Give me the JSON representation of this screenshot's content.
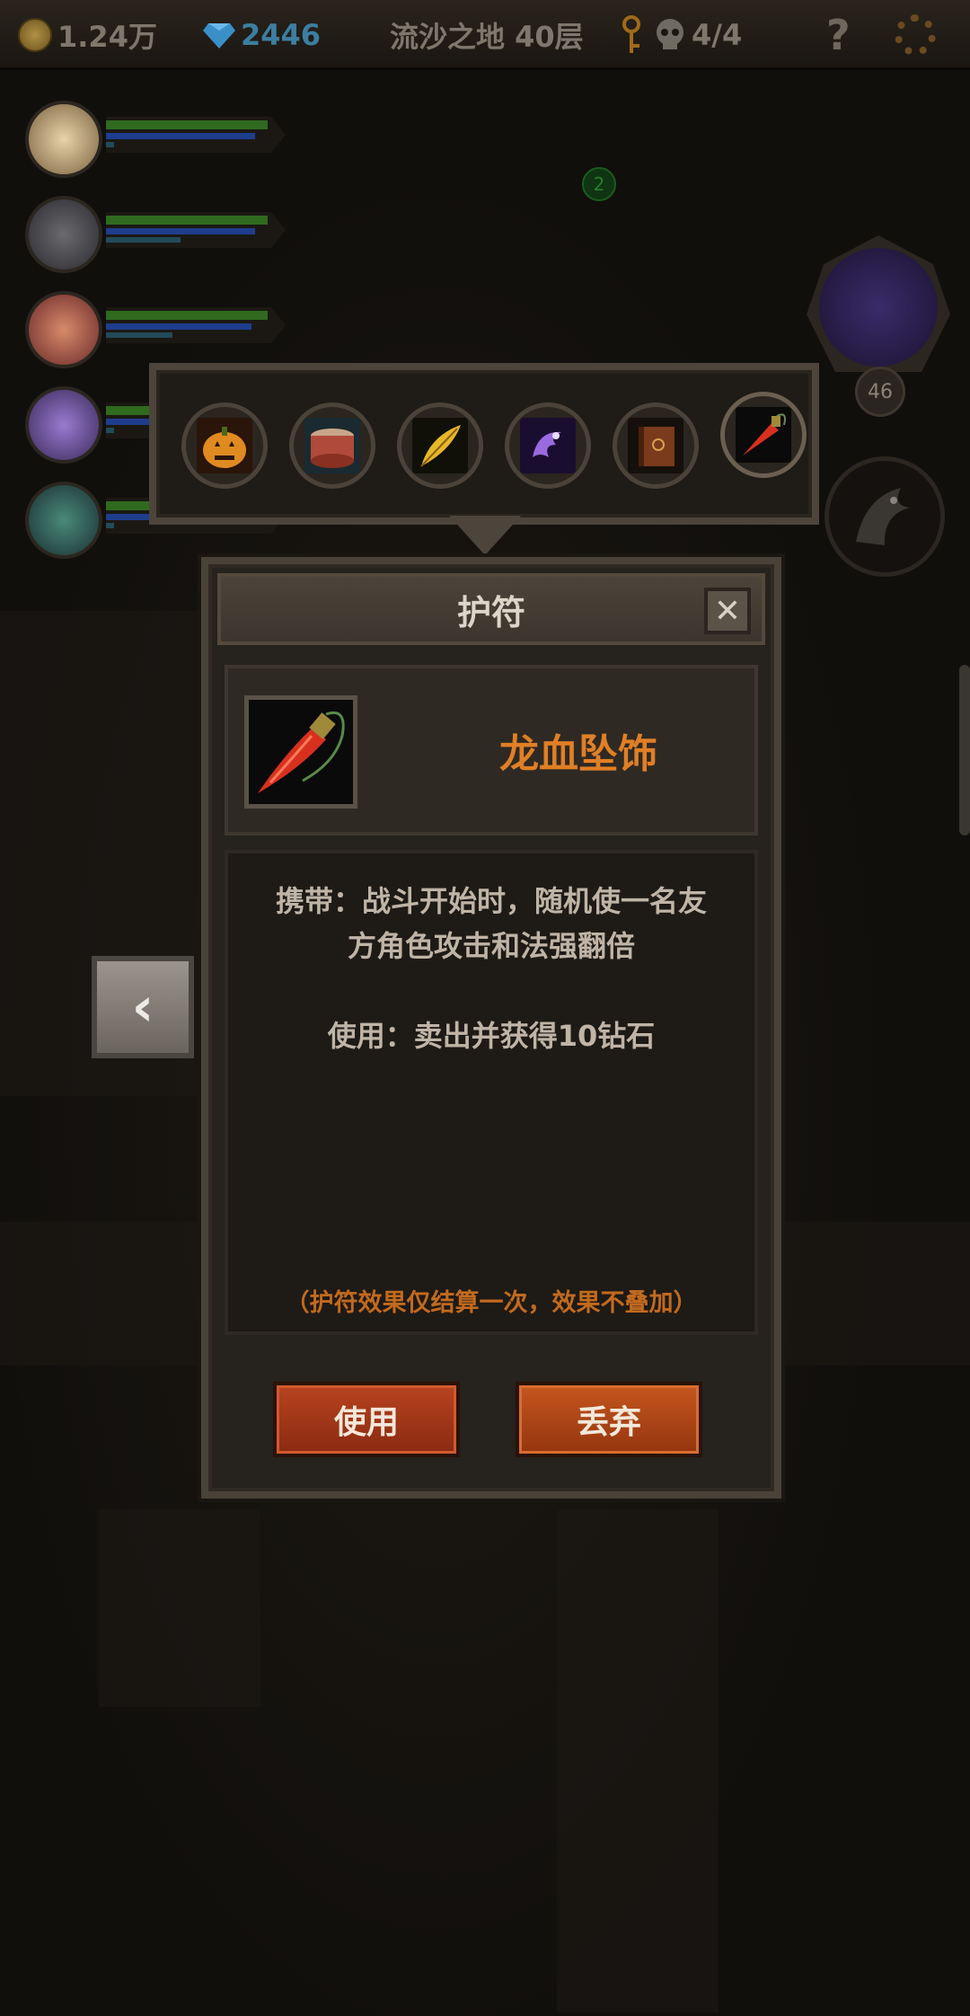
{
  "topbar": {
    "gold": "1.24万",
    "diamonds": "2446",
    "location": "流沙之地 40层",
    "kills": "4/4",
    "help_label": "?"
  },
  "heroes": [
    {
      "hp": 0.98,
      "mp": 0.9,
      "xp": 0.05
    },
    {
      "hp": 0.98,
      "mp": 0.9,
      "xp": 0.45
    },
    {
      "hp": 0.98,
      "mp": 0.88,
      "xp": 0.4
    },
    {
      "hp": 0.98,
      "mp": 0.9,
      "xp": 0.05
    },
    {
      "hp": 0.98,
      "mp": 0.9,
      "xp": 0.05
    }
  ],
  "map": {
    "marker_count": "2",
    "boss_level": "46"
  },
  "amulet_tray": {
    "slots": [
      {
        "icon": "pumpkin-icon",
        "color": "#e08a22"
      },
      {
        "icon": "drum-icon",
        "color": "#b04a3a"
      },
      {
        "icon": "feather-icon",
        "color": "#e7b72a"
      },
      {
        "icon": "spirit-icon",
        "color": "#7a4bd0"
      },
      {
        "icon": "book-icon",
        "color": "#7a3a1c"
      },
      {
        "icon": "pendant-icon",
        "color": "#d8301e",
        "selected": true
      }
    ]
  },
  "dialog": {
    "title": "护符",
    "close_label": "✕",
    "item_name": "龙血坠饰",
    "description_line1": "携带：战斗开始时，随机使一名友",
    "description_line2": "方角色攻击和法强翻倍",
    "use_effect": "使用：卖出并获得10钻石",
    "note": "（护符效果仅结算一次，效果不叠加）",
    "use_button": "使用",
    "discard_button": "丢弃"
  },
  "nav": {
    "prev_label": "‹"
  },
  "colors": {
    "accent_orange": "#e07f26",
    "note_orange": "#c26a1e",
    "button_red": "#b8431f"
  }
}
